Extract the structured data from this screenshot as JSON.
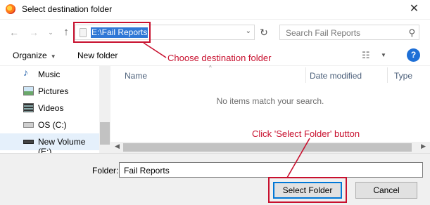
{
  "window": {
    "title": "Select destination folder",
    "close_glyph": "✕",
    "app_icon": "firefox-icon"
  },
  "navigation": {
    "back_glyph": "←",
    "forward_glyph": "→",
    "recent_glyph": "⌄",
    "up_glyph": "↑",
    "address_path": "E:\\Fail Reports",
    "address_dropdown_glyph": "⌄",
    "refresh_glyph": "↻",
    "search_placeholder": "Search Fail Reports",
    "search_glyph": "⚲"
  },
  "toolbar": {
    "organize_label": "Organize",
    "organize_caret": "▼",
    "new_folder_label": "New folder",
    "view_glyph": "☷",
    "view_caret": "▼",
    "help_glyph": "?"
  },
  "sidebar": {
    "items": [
      {
        "label": "Music",
        "icon": "music-icon",
        "selected": false
      },
      {
        "label": "Pictures",
        "icon": "pictures-icon",
        "selected": false
      },
      {
        "label": "Videos",
        "icon": "videos-icon",
        "selected": false
      },
      {
        "label": "OS (C:)",
        "icon": "drive-icon",
        "selected": false
      },
      {
        "label": "New Volume (E:)",
        "icon": "drive-icon",
        "selected": true
      }
    ]
  },
  "file_list": {
    "sort_caret": "^",
    "columns": [
      "Name",
      "Date modified",
      "Type"
    ],
    "empty_message": "No items match your search.",
    "scroll_left": "◀",
    "scroll_right": "▶"
  },
  "footer": {
    "folder_label": "Folder:",
    "folder_value": "Fail Reports",
    "select_button": "Select Folder",
    "cancel_button": "Cancel"
  },
  "annotations": {
    "color": "#c8102e",
    "choose_text": "Choose destination folder",
    "click_text": "Click 'Select Folder' button"
  },
  "colors": {
    "selection_blue": "#3078d6",
    "sidebar_selected": "#e5f0fb",
    "help_blue": "#1e6fd6"
  }
}
